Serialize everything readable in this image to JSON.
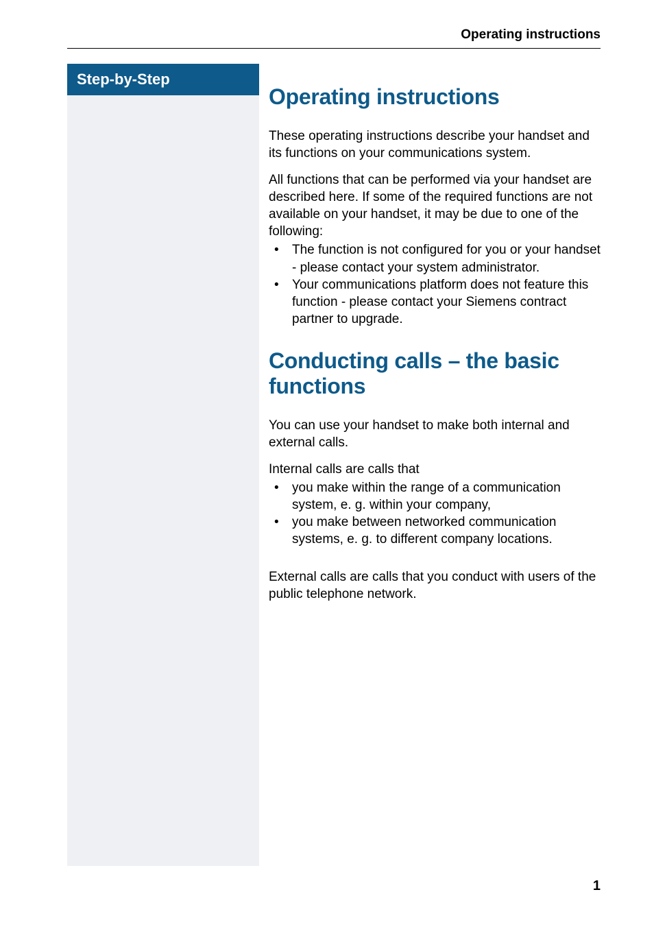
{
  "header": {
    "running_title": "Operating instructions"
  },
  "sidebar": {
    "title": "Step-by-Step"
  },
  "content": {
    "h1_a": "Operating instructions",
    "p1": "These operating instructions describe your handset and its functions on your communications system.",
    "p2": "All functions that can be performed via your handset are described here. If some of the required functions are not available on your handset, it may be due to one of the following:",
    "list_a": [
      "The function is not configured for you or your handset - please contact your system administrator.",
      "Your communications platform does not feature this function - please contact your Siemens contract partner to upgrade."
    ],
    "h1_b": "Conducting calls – the basic functions",
    "p3": "You can use your handset to make both internal and external calls.",
    "p4": "Internal calls are calls that",
    "list_b": [
      "you make within the range of a communication system, e. g. within your company,",
      "you make between networked communication systems, e. g. to different company locations."
    ],
    "p5": "External calls are calls that you conduct with users of the public telephone network."
  },
  "footer": {
    "page_number": "1"
  }
}
